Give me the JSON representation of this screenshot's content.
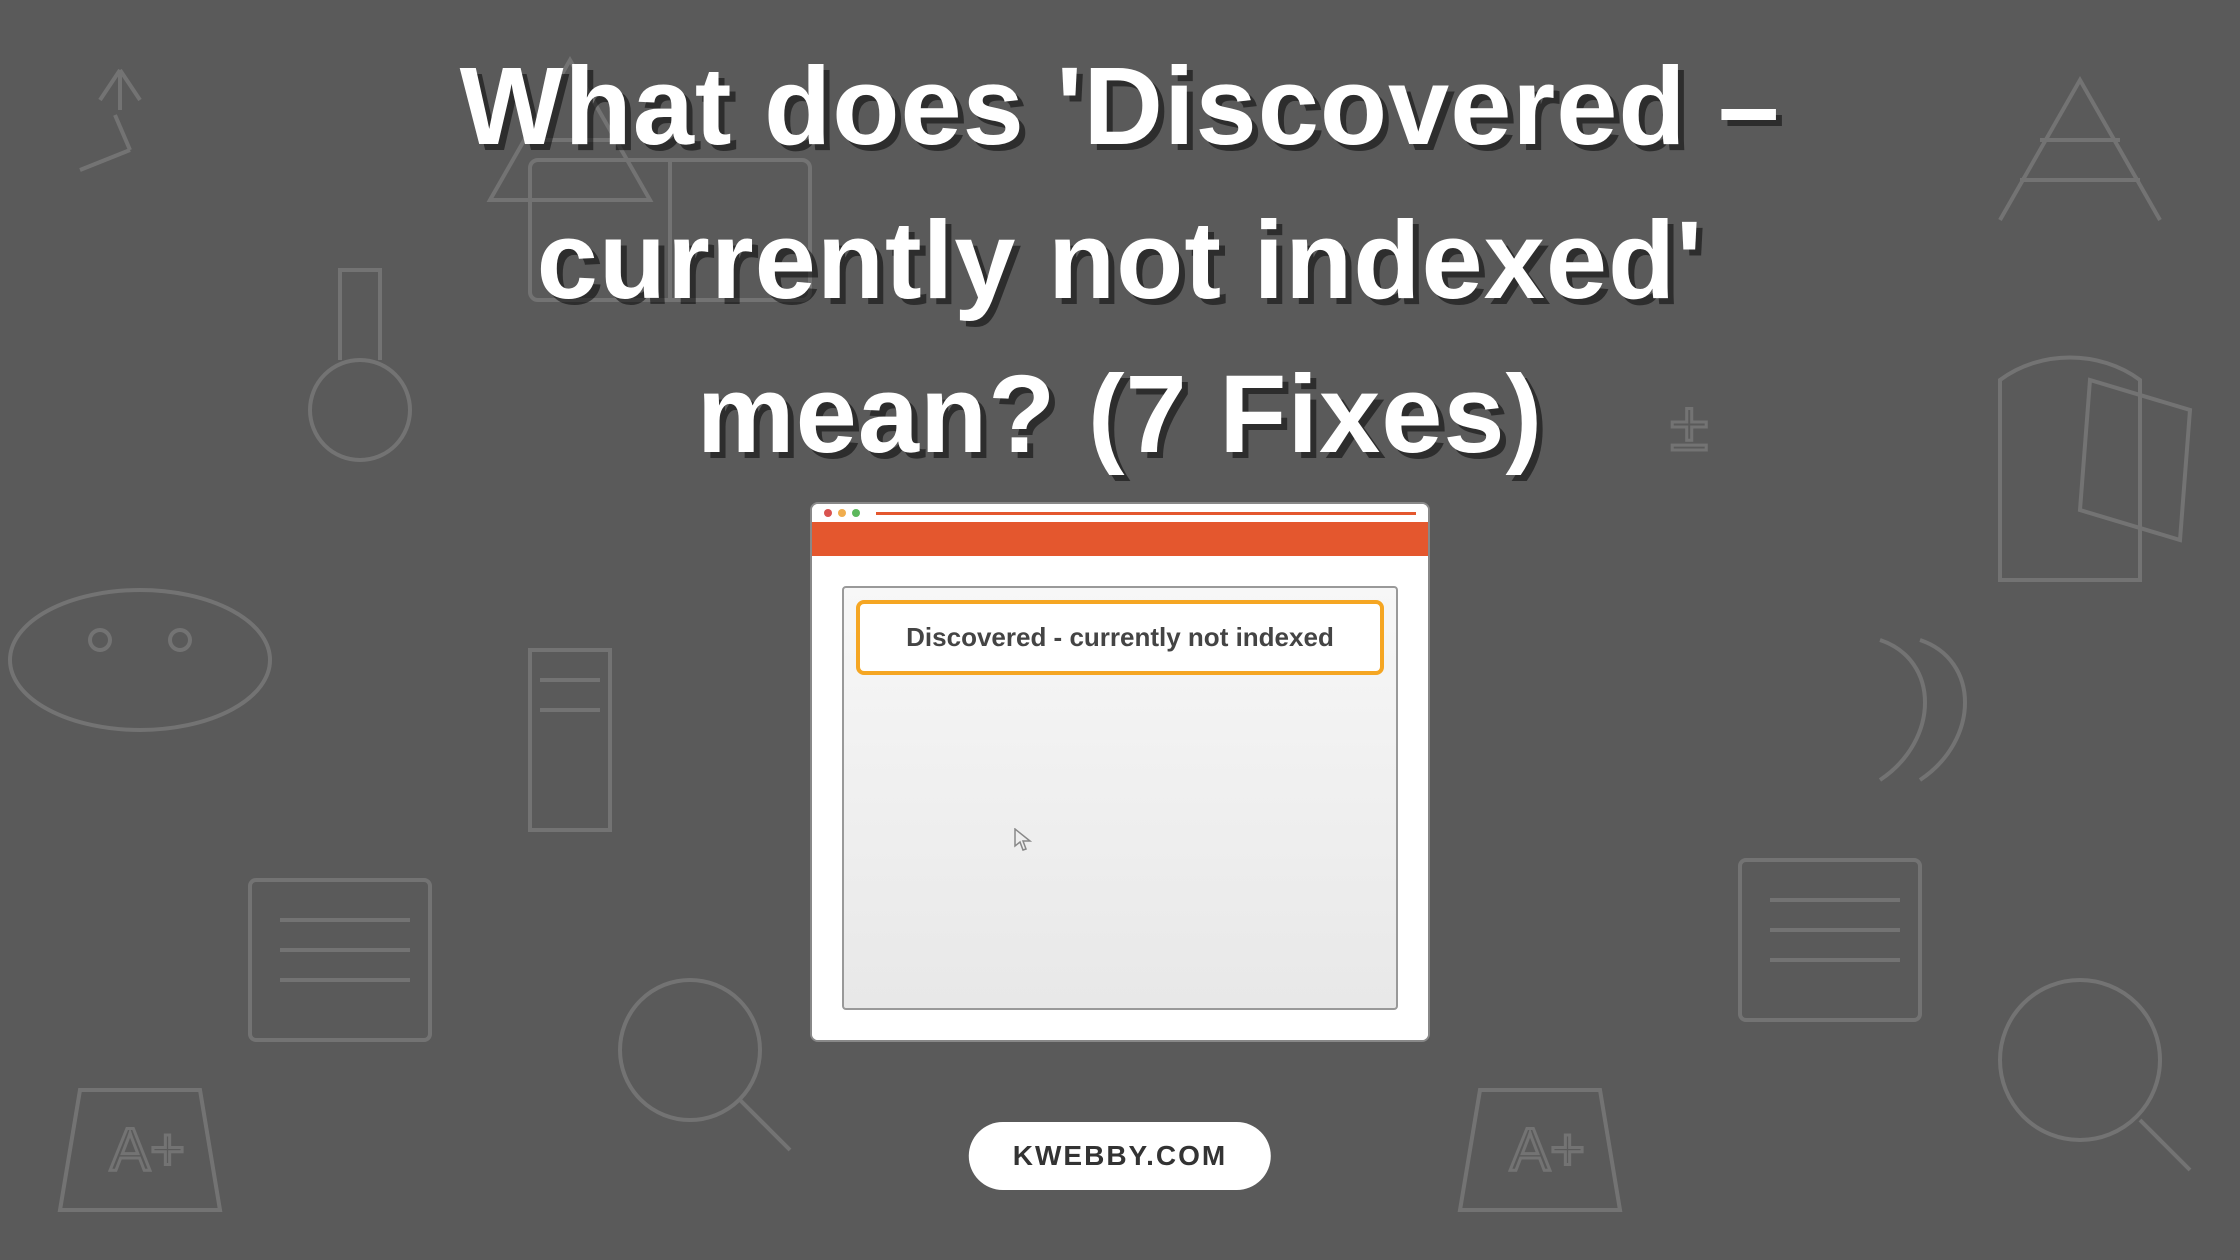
{
  "title": "What does 'Discovered – currently not indexed' mean? (7 Fixes)",
  "status_label": "Discovered - currently not indexed",
  "site_badge": "KWEBBY.COM"
}
